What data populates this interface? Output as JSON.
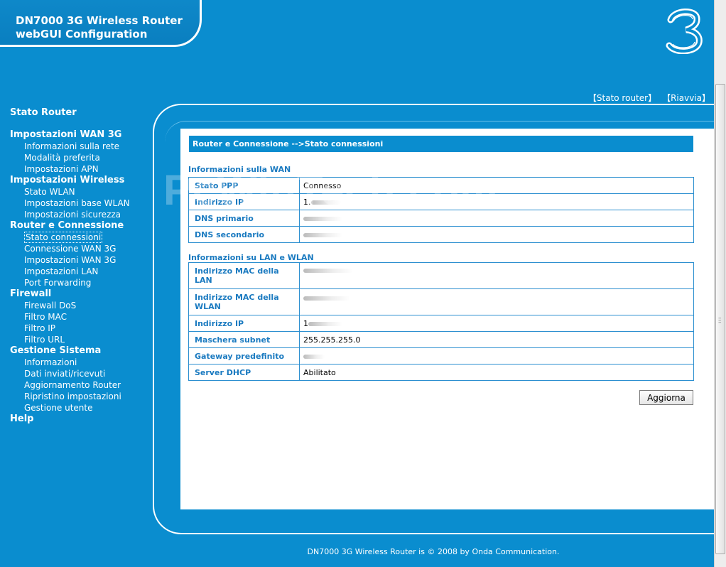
{
  "header": {
    "title_line1": "DN7000 3G Wireless Router",
    "title_line2": "webGUI Configuration",
    "logo_icon": "three-logo"
  },
  "top_links": {
    "stato_router": "【Stato router】",
    "riavvia": "【Riavvia】"
  },
  "sidebar": {
    "stato_router": "Stato Router",
    "groups": [
      {
        "title": "Impostazioni WAN 3G",
        "items": [
          "Informazioni sulla rete",
          "Modalità preferita",
          "Impostazioni APN"
        ]
      },
      {
        "title": "Impostazioni Wireless",
        "items": [
          "Stato WLAN",
          "Impostazioni base WLAN",
          "Impostazioni sicurezza"
        ]
      },
      {
        "title": "Router e Connessione",
        "items": [
          "Stato connessioni",
          "Connessione WAN 3G",
          "Impostazioni WAN 3G",
          "Impostazioni LAN",
          "Port Forwarding"
        ]
      },
      {
        "title": "Firewall",
        "items": [
          "Firewall DoS",
          "Filtro MAC",
          "Filtro IP",
          "Filtro URL"
        ]
      },
      {
        "title": "Gestione Sistema",
        "items": [
          "Informazioni",
          "Dati inviati/ricevuti",
          "Aggiornamento Router",
          "Ripristino impostazioni",
          "Gestione utente"
        ]
      }
    ],
    "help": "Help",
    "active_item": "Stato connessioni"
  },
  "main": {
    "breadcrumb": "Router e Connessione -->Stato connessioni",
    "wan_title": "Informazioni sulla WAN",
    "wan_rows": [
      {
        "label": "Stato PPP",
        "value": "Connesso"
      },
      {
        "label": "Indirizzo IP",
        "value": "1."
      },
      {
        "label": "DNS primario",
        "value": ""
      },
      {
        "label": "DNS secondario",
        "value": ""
      }
    ],
    "lan_title": "Informazioni su LAN e WLAN",
    "lan_rows": [
      {
        "label": "Indirizzo MAC della LAN",
        "value": ""
      },
      {
        "label": "Indirizzo MAC della WLAN",
        "value": ""
      },
      {
        "label": "Indirizzo IP",
        "value": "1"
      },
      {
        "label": "Maschera subnet",
        "value": "255.255.255.0"
      },
      {
        "label": "Gateway predefinito",
        "value": ""
      },
      {
        "label": "Server DHCP",
        "value": "Abilitato"
      }
    ],
    "refresh_button": "Aggiorna"
  },
  "watermark": "PcWinTech.com",
  "footer": "DN7000 3G Wireless Router is © 2008 by Onda Communication."
}
